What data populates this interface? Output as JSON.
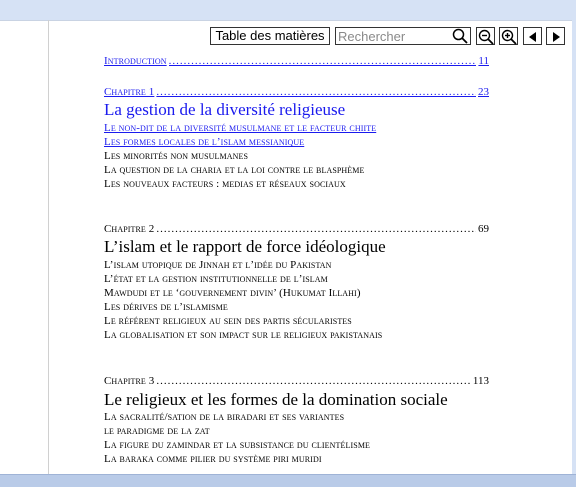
{
  "toolbar": {
    "toc_label": "Table des matières",
    "search_placeholder": "Rechercher"
  },
  "toc": {
    "introduction": {
      "label": "Introduction",
      "page": "11"
    },
    "chapters": [
      {
        "label": "Chapitre 1",
        "page": "23",
        "title": "La gestion de la diversité religieuse",
        "sections": [
          "Le non-dit de la diversité musulmane et le facteur chiite",
          "Les formes locales de l’islam messianique",
          "Les minorités non musulmanes",
          "La question de la charia et la loi contre le blasphème",
          "Les nouveaux facteurs : medias et réseaux sociaux"
        ]
      },
      {
        "label": "Chapitre 2",
        "page": "69",
        "title": "L’islam et le rapport de force idéologique",
        "sections": [
          "L’islam utopique de Jinnah et l’idée du Pakistan",
          "L’état et la gestion institutionnelle de l’islam",
          "Mawdudi et le ‘gouvernement divin’ (Hukumat Illahi)",
          "Les dérives de l’islamisme",
          "Le référent religieux au sein des partis sécularistes",
          "La globalisation et son impact sur le religieux pakistanais"
        ]
      },
      {
        "label": "Chapitre 3",
        "page": "113",
        "title": "Le religieux et les formes de la domination sociale",
        "sections": [
          "La sacralité/sation de la biradari et ses variantes",
          "le paradigme de la zat",
          "La figure du zamindar et la subsistance du clientélisme",
          "La baraka comme pilier du système piri muridi"
        ]
      }
    ]
  }
}
